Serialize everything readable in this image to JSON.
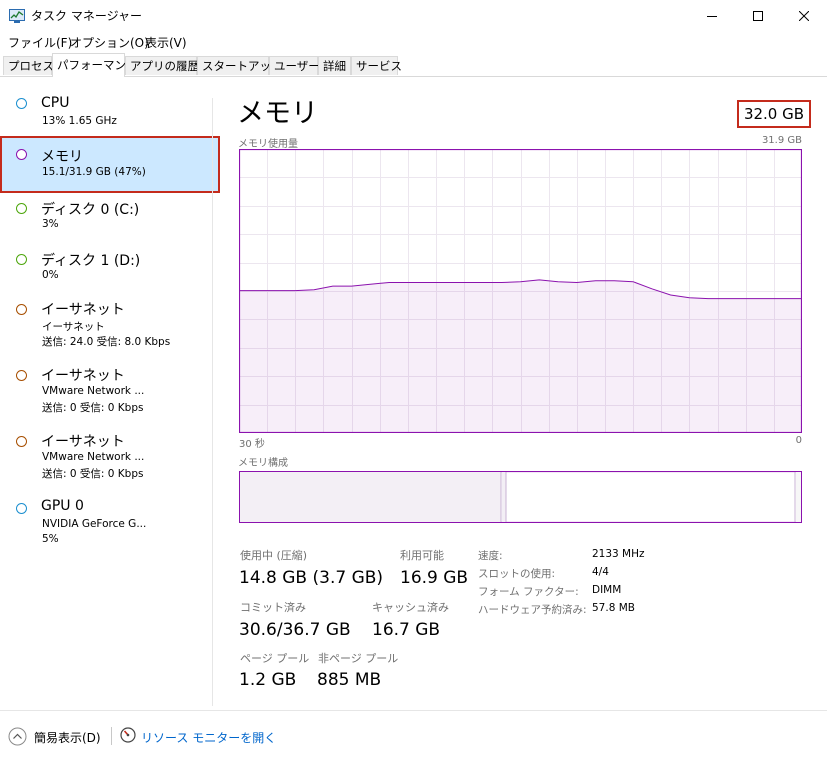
{
  "window": {
    "title": "タスク マネージャー"
  },
  "menu": [
    "ファイル(F)",
    "オプション(O)",
    "表示(V)"
  ],
  "tabs": [
    "プロセス",
    "パフォーマンス",
    "アプリの履歴",
    "スタートアップ",
    "ユーザー",
    "詳細",
    "サービス"
  ],
  "sidebar": [
    {
      "name": "CPU",
      "line1": "13%  1.65 GHz",
      "line2": "",
      "color": "#1b8fcf"
    },
    {
      "name": "メモリ",
      "line1": "15.1/31.9 GB (47%)",
      "line2": "",
      "color": "#8b12ae"
    },
    {
      "name": "ディスク 0 (C:)",
      "line1": "3%",
      "line2": "",
      "color": "#4da60c"
    },
    {
      "name": "ディスク 1 (D:)",
      "line1": "0%",
      "line2": "",
      "color": "#4da60c"
    },
    {
      "name": "イーサネット",
      "line1": "イーサネット",
      "line2": "送信: 24.0  受信: 8.0 Kbps",
      "color": "#a74f01"
    },
    {
      "name": "イーサネット",
      "line1": "VMware Network ...",
      "line2": "送信: 0  受信: 0 Kbps",
      "color": "#a74f01"
    },
    {
      "name": "イーサネット",
      "line1": "VMware Network ...",
      "line2": "送信: 0  受信: 0 Kbps",
      "color": "#a74f01"
    },
    {
      "name": "GPU 0",
      "line1": "NVIDIA GeForce G...",
      "line2": "5%",
      "color": "#1b8fcf"
    }
  ],
  "main": {
    "title": "メモリ",
    "total": "32.0 GB",
    "usage_label": "メモリ使用量",
    "usage_max": "31.9 GB",
    "time_left": "30 秒",
    "time_right": "0",
    "composition_label": "メモリ構成",
    "stats": {
      "in_use_label": "使用中 (圧縮)",
      "in_use_value": "14.8 GB (3.7 GB)",
      "available_label": "利用可能",
      "available_value": "16.9 GB",
      "committed_label": "コミット済み",
      "committed_value": "30.6/36.7 GB",
      "cached_label": "キャッシュ済み",
      "cached_value": "16.7 GB",
      "paged_label": "ページ プール",
      "paged_value": "1.2 GB",
      "nonpaged_label": "非ページ プール",
      "nonpaged_value": "885 MB"
    },
    "details": [
      {
        "label": "速度:",
        "value": "2133 MHz"
      },
      {
        "label": "スロットの使用:",
        "value": "4/4"
      },
      {
        "label": "フォーム ファクター:",
        "value": "DIMM"
      },
      {
        "label": "ハードウェア予約済み:",
        "value": "57.8 MB"
      }
    ]
  },
  "chart_data": {
    "type": "area",
    "title": "メモリ使用量",
    "xlabel": "",
    "ylabel": "",
    "ylim": [
      0,
      31.9
    ],
    "x": [
      30,
      29,
      28,
      27,
      26,
      25,
      24,
      23,
      22,
      21,
      20,
      19,
      18,
      17,
      16,
      15,
      14,
      13,
      12,
      11,
      10,
      9,
      8,
      7,
      6,
      5,
      4,
      3,
      2,
      1,
      0
    ],
    "series": [
      {
        "values": [
          16.0,
          16.0,
          16.0,
          16.0,
          16.1,
          16.5,
          16.5,
          16.7,
          16.9,
          16.9,
          16.9,
          16.9,
          16.9,
          16.9,
          16.9,
          17.0,
          17.2,
          17.0,
          16.9,
          17.1,
          17.1,
          17.0,
          16.2,
          15.5,
          15.2,
          15.1,
          15.1,
          15.1,
          15.1,
          15.1,
          15.1
        ]
      }
    ],
    "color": "#8b12ae",
    "grid": true
  },
  "footer": {
    "fewer_details": "簡易表示(D)",
    "resource_monitor": "リソース モニターを開く"
  },
  "colors": {
    "selected_bg": "#cce8ff",
    "highlight_box": "#c42b1c",
    "memory_accent": "#8b12ae"
  }
}
